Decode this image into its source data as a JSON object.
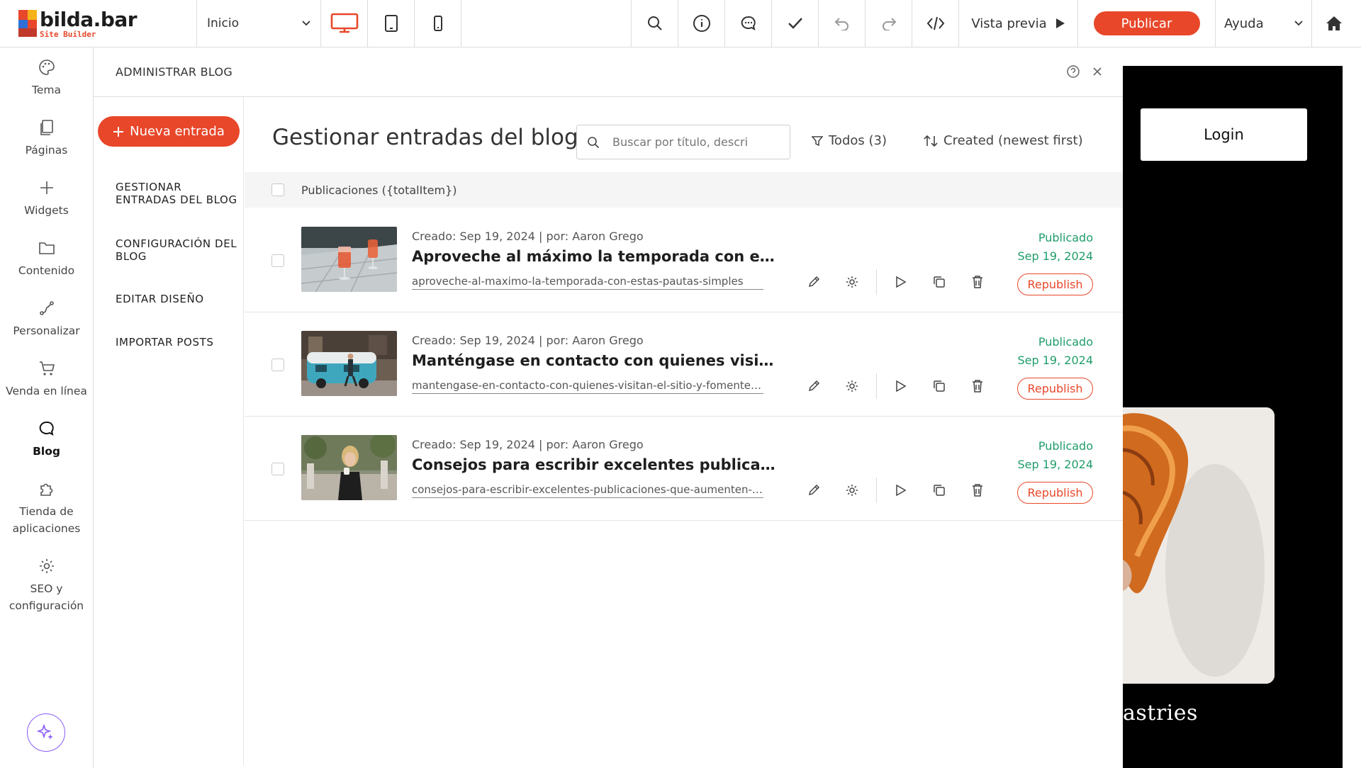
{
  "brand": {
    "name": "bilda.bar",
    "subtitle": "Site Builder",
    "accent": "#e8472a"
  },
  "toolbar": {
    "page_selector": "Inicio",
    "devices": [
      "desktop-icon",
      "tablet-icon",
      "mobile-icon"
    ],
    "active_device": "desktop",
    "tools": [
      "search-icon",
      "info-icon",
      "comment-icon",
      "check-icon",
      "undo-icon",
      "redo-icon",
      "code-icon"
    ],
    "preview_label": "Vista previa",
    "publish_label": "Publicar",
    "help_label": "Ayuda"
  },
  "sidebar": {
    "items": [
      {
        "label": "Tema",
        "icon": "palette-icon"
      },
      {
        "label": "Páginas",
        "icon": "pages-icon"
      },
      {
        "label": "Widgets",
        "icon": "plus-icon"
      },
      {
        "label": "Contenido",
        "icon": "folder-icon"
      },
      {
        "label": "Personalizar",
        "icon": "path-icon"
      },
      {
        "label": "Venda en línea",
        "icon": "cart-icon"
      },
      {
        "label": "Blog",
        "icon": "chat-bubble-icon"
      },
      {
        "label": "Tienda de aplicaciones",
        "icon": "puzzle-icon"
      },
      {
        "label": "SEO y configuración",
        "icon": "gear-icon"
      }
    ],
    "active": "Blog"
  },
  "panel": {
    "header": "ADMINISTRAR BLOG",
    "new_entry_label": "Nueva entrada",
    "nav": [
      "GESTIONAR ENTRADAS DEL BLOG",
      "CONFIGURACIÓN DEL BLOG",
      "EDITAR DISEÑO",
      "IMPORTAR POSTS"
    ],
    "title": "Gestionar entradas del blog",
    "search_placeholder": "Buscar por título, descri",
    "filter_label": "Todos (3)",
    "sort_label": "Created (newest first)",
    "list_header": "Publicaciones ({totalItem})"
  },
  "posts": [
    {
      "meta": "Creado: Sep 19, 2024 | por: Aaron Grego",
      "title": "Aproveche al máximo la temporada con estas pautas simples",
      "slug": "aproveche-al-maximo-la-temporada-con-estas-pautas-simples",
      "status": "Publicado",
      "date": "Sep 19, 2024",
      "action_label": "Republish"
    },
    {
      "meta": "Creado: Sep 19, 2024 | por: Aaron Grego",
      "title": "Manténgase en contacto con quienes visitan el sitio y fomente",
      "slug": "mantengase-en-contacto-con-quienes-visitan-el-sitio-y-fomente-la-participacion",
      "status": "Publicado",
      "date": "Sep 19, 2024",
      "action_label": "Republish"
    },
    {
      "meta": "Creado: Sep 19, 2024 | por: Aaron Grego",
      "title": "Consejos para escribir excelentes publicaciones que aumenten",
      "slug": "consejos-para-escribir-excelentes-publicaciones-que-aumenten-el-trafico",
      "status": "Publicado",
      "date": "Sep 19, 2024",
      "action_label": "Republish"
    }
  ],
  "site_preview": {
    "login_label": "Login",
    "caption": "astries"
  }
}
